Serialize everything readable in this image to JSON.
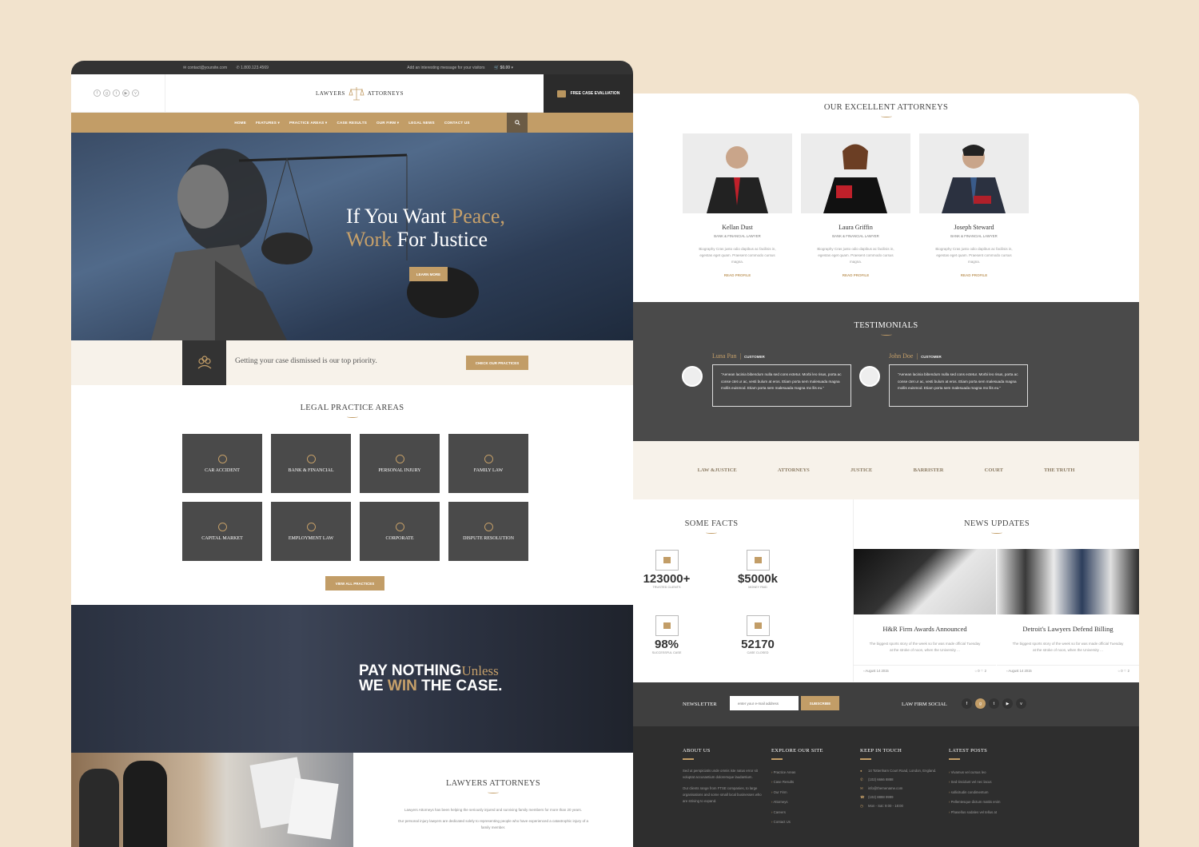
{
  "topbar": {
    "email": "contact@yoursite.com",
    "phone": "1.800.123.4569",
    "message": "Add an interesting message for your visitors",
    "cart": "$0.00"
  },
  "header": {
    "logo_left": "LAWYERS",
    "logo_right": "ATTORNEYS",
    "cta": "FREE CASE EVALUATION"
  },
  "nav": {
    "items": [
      "HOME",
      "FEATURES",
      "PRACTICE AREAS",
      "CASE RESULTS",
      "OUR FIRM",
      "LEGAL NEWS",
      "CONTACT US"
    ]
  },
  "hero": {
    "line1a": "If You Want ",
    "line1b": "Peace,",
    "line2a": "Work ",
    "line2b": "For Justice",
    "button": "LEARN MORE"
  },
  "priority": {
    "text": "Getting your case dismissed is our top priority.",
    "button": "CHECK OUR PRACTICES"
  },
  "practice": {
    "title": "LEGAL PRACTICE AREAS",
    "tiles": [
      "CAR ACCIDENT",
      "BANK & FINANCIAL",
      "PERSONAL INJURY",
      "FAMILY LAW",
      "CAPITAL MARKET",
      "EMPLOYMENT LAW",
      "CORPORATE",
      "DISPUTE RESOLUTION"
    ],
    "button": "VIEW ALL PRACTICES"
  },
  "pay": {
    "p1": "PAY NOTHING",
    "p2": "Unless",
    "w1": "WE ",
    "w2": "WIN",
    "w3": " THE CASE."
  },
  "about": {
    "title": "LAWYERS ATTORNEYS",
    "p1": "Lawyers Attorneys has been helping the seriously injured and surviving family members for more than 20 years.",
    "p2": "Our personal injury lawyers are dedicated solely to representing people who have experienced a catastrophic injury of a family member."
  },
  "attorneys": {
    "title": "OUR EXCELLENT ATTORNEYS",
    "items": [
      {
        "name": "Kellan Dust",
        "role": "BANK & FINANCIAL LAWYER",
        "bio": "Biography Cras justo odio dapibus ac facilisis in, egestas eget quam. Praesent commodo cursus magna.",
        "link": "READ PROFILE"
      },
      {
        "name": "Laura Griffin",
        "role": "BANK & FINANCIAL LAWYER",
        "bio": "Biography Cras justo odio dapibus ac facilisis in, egestas eget quam. Praesent commodo cursus magna.",
        "link": "READ PROFILE"
      },
      {
        "name": "Joseph Steward",
        "role": "BANK & FINANCIAL LAWYER",
        "bio": "Biography Cras justo odio dapibus ac facilisis in, egestas eget quam. Praesent commodo cursus magna.",
        "link": "READ PROFILE"
      }
    ]
  },
  "testimonials": {
    "title": "TESTIMONIALS",
    "items": [
      {
        "name": "Luna Pan",
        "tag": "CUSTOMER",
        "quote": "\"Aenean lacinia bibendum nulla sed cons ectetur. Morbi leo risus, porta ac conse ctet ur ac, vesti bulum at eros. Etiam porta sem malesuada magna mollis euismod. Etiam porta sem malesuada magna mo llis eu.\""
      },
      {
        "name": "John Doe",
        "tag": "CUSTOMER",
        "quote": "\"Aenean lacinia bibendum nulla sed cons ectetur. Morbi leo risus, porta ac conse ctet ur ac, vesti bulum at eros. Etiam porta sem malesuada magna mollis euismod. Etiam porta sem malesuada magna mo llis eu.\""
      }
    ]
  },
  "logos": [
    "LAW &JUSTICE",
    "ATTORNEYS",
    "JUSTICE",
    "BARRISTER",
    "COURT",
    "THE TRUTH"
  ],
  "facts": {
    "title": "SOME FACTS",
    "items": [
      {
        "num": "123000+",
        "label": "TRUSTED CLIENTS"
      },
      {
        "num": "$5000k",
        "label": "MONEY PAID"
      },
      {
        "num": "98%",
        "label": "SUCCESSFUL CASE"
      },
      {
        "num": "52170",
        "label": "CASE CLOSED"
      }
    ]
  },
  "news": {
    "title": "NEWS UPDATES",
    "items": [
      {
        "head": "H&R Firm Awards Announced",
        "desc": "The biggest sports story of the week so far was made official Tuesday at the stroke of noon, when the University ...",
        "date": "August 14 2015",
        "comments": "0",
        "likes": "2"
      },
      {
        "head": "Detroit's Lawyers Defend Billing",
        "desc": "The biggest sports story of the week so far was made official Tuesday at the stroke of noon, when the University ...",
        "date": "August 14 2015",
        "comments": "0",
        "likes": "2"
      }
    ]
  },
  "newsletter": {
    "label": "NEWSLETTER",
    "placeholder": "enter your e-mail address",
    "button": "SUBSCRIBE",
    "social_label": "LAW FIRM SOCIAL"
  },
  "footer": {
    "about": {
      "title": "ABOUT US",
      "p1": "Sed ut perspiciatis unde omnis iste natus error sit voluptat accusantium doloremque laudantium.",
      "p2": "Our clients range from FTSE companies, to large organisations and some small local businesses who are striving to expand."
    },
    "explore": {
      "title": "EXPLORE OUR SITE",
      "links": [
        "Practice Areas",
        "Case Results",
        "Our Firm",
        "Attorneys",
        "Careers",
        "Contact Us"
      ]
    },
    "contact": {
      "title": "KEEP IN TOUCH",
      "lines": [
        "14 Tottenham Court Road, London, England.",
        "(102) 6666 8888",
        "info@themename.com",
        "(102) 8888 9999",
        "Mon - Sat: 9:00 - 18:00"
      ]
    },
    "posts": {
      "title": "LATEST POSTS",
      "links": [
        "Vivamus vel cursus leo",
        "Sed tincidunt vel nec lacus",
        "sollicitudin condimentum",
        "Pellentesque dictum mattis enim",
        "Phasellus sodales vel tellus at"
      ]
    }
  },
  "colors": {
    "accent": "#c29d67",
    "dark": "#333333",
    "bg": "#f2e3cd"
  }
}
